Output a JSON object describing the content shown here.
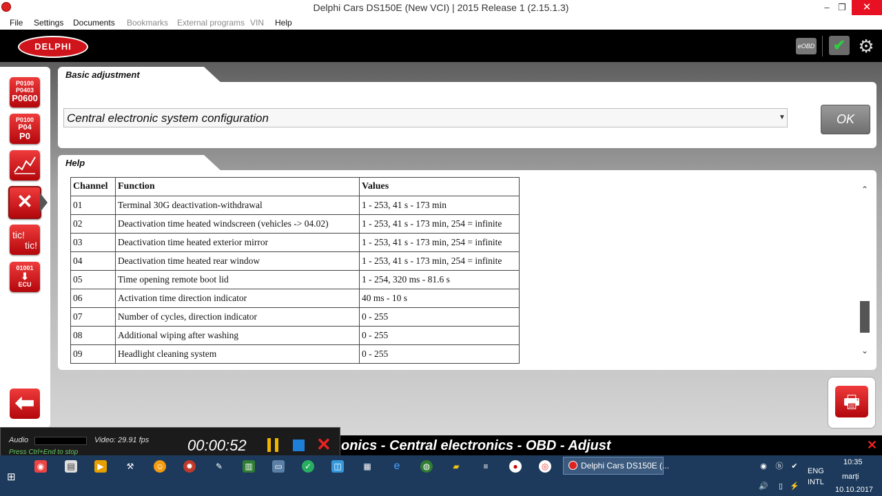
{
  "window": {
    "title": "Delphi Cars DS150E (New VCI) | 2015 Release 1 (2.15.1.3)",
    "minimize_glyph": "–",
    "restore_glyph": "❐",
    "close_glyph": "✕"
  },
  "menubar": {
    "items": [
      {
        "label": "File",
        "enabled": true
      },
      {
        "label": "Settings",
        "enabled": true
      },
      {
        "label": "Documents",
        "enabled": true
      },
      {
        "label": "Bookmarks",
        "enabled": false
      },
      {
        "label": "External programs",
        "enabled": false
      },
      {
        "label": "VIN",
        "enabled": false
      },
      {
        "label": "Help",
        "enabled": true
      }
    ]
  },
  "header": {
    "logo_text": "DELPHI",
    "eobd_label": "eOBD"
  },
  "sidebar": {
    "buttons": [
      {
        "lines": [
          "P0100",
          "P0403",
          "P0600"
        ]
      },
      {
        "lines": [
          "P0100",
          "P04",
          "P0"
        ]
      },
      {
        "lines": [
          "",
          ""
        ]
      },
      {
        "lines": [
          "✕"
        ]
      },
      {
        "lines": [
          "tic!",
          "tic!"
        ]
      },
      {
        "lines": [
          "01001",
          "⬇",
          "ECU"
        ]
      }
    ]
  },
  "basic_adjustment": {
    "tab_label": "Basic adjustment",
    "selected_option": "Central electronic system configuration",
    "ok_label": "OK"
  },
  "help": {
    "tab_label": "Help",
    "columns": [
      "Channel",
      "Function",
      "Values"
    ],
    "rows": [
      [
        "01",
        "Terminal 30G deactivation-withdrawal",
        "1 - 253, 41 s - 173 min"
      ],
      [
        "02",
        "Deactivation time heated windscreen (vehicles -> 04.02)",
        "1 - 253, 41 s - 173 min, 254 = infinite"
      ],
      [
        "03",
        "Deactivation time heated exterior mirror",
        "1 - 253, 41 s - 173 min, 254 = infinite"
      ],
      [
        "04",
        "Deactivation time heated rear window",
        "1 - 253, 41 s - 173 min, 254 = infinite"
      ],
      [
        "05",
        "Time opening remote boot lid",
        "1 - 254, 320 ms - 81.6 s"
      ],
      [
        "06",
        "Activation time direction indicator",
        "40 ms - 10 s"
      ],
      [
        "07",
        "Number of cycles, direction indicator",
        "0 - 255"
      ],
      [
        "08",
        "Additional wiping after washing",
        "0 - 255"
      ],
      [
        "09",
        "Headlight cleaning system",
        "0 - 255"
      ]
    ]
  },
  "statusbar": {
    "text": "onics - Central electronics - OBD - Adjust"
  },
  "recorder": {
    "audio_label": "Audio",
    "video_label": "Video: 29.91 fps",
    "hint": "Press Ctrl+End to stop",
    "timer": "00:00:52"
  },
  "taskbar": {
    "active_app_label": "Delphi Cars DS150E (...",
    "lang_1": "ENG",
    "lang_2": "INTL",
    "time": "10:35",
    "day": "marți",
    "date": "10.10.2017"
  }
}
